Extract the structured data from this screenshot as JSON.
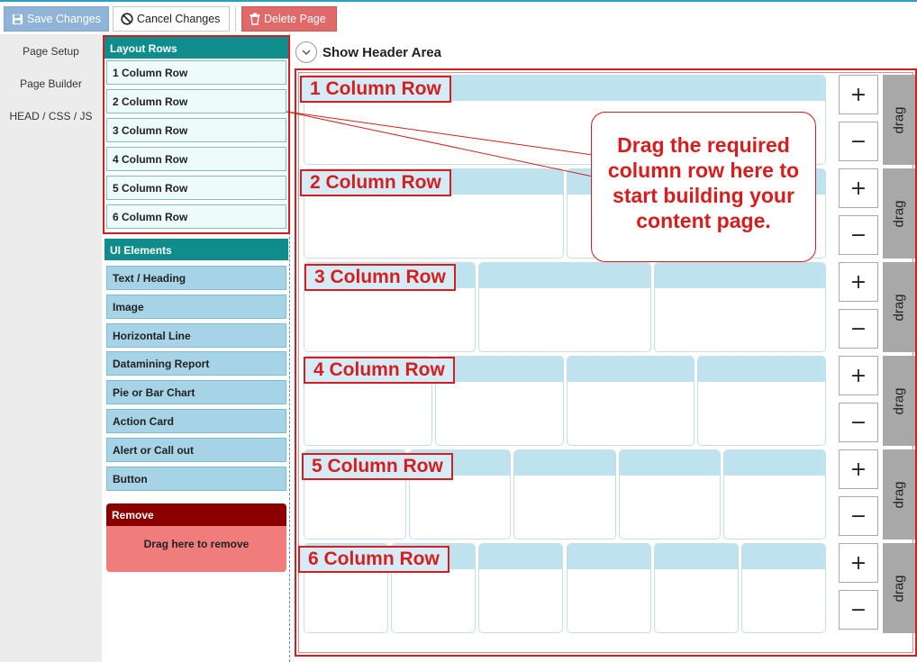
{
  "toolbar": {
    "save_label": "Save Changes",
    "cancel_label": "Cancel Changes",
    "delete_label": "Delete Page"
  },
  "left_nav": {
    "items": [
      {
        "label": "Page Setup"
      },
      {
        "label": "Page Builder"
      },
      {
        "label": "HEAD / CSS / JS"
      }
    ]
  },
  "palette": {
    "layout_rows_title": "Layout Rows",
    "layout_rows": [
      {
        "label": "1 Column Row"
      },
      {
        "label": "2 Column Row"
      },
      {
        "label": "3 Column Row"
      },
      {
        "label": "4 Column Row"
      },
      {
        "label": "5 Column Row"
      },
      {
        "label": "6 Column Row"
      }
    ],
    "ui_elements_title": "UI Elements",
    "ui_elements": [
      {
        "label": "Text / Heading"
      },
      {
        "label": "Image"
      },
      {
        "label": "Horizontal Line"
      },
      {
        "label": "Datamining Report"
      },
      {
        "label": "Pie or Bar Chart"
      },
      {
        "label": "Action Card"
      },
      {
        "label": "Alert or Call out"
      },
      {
        "label": "Button"
      }
    ],
    "remove_title": "Remove",
    "remove_text": "Drag here to remove"
  },
  "main": {
    "header_toggle_label": "Show Header Area",
    "rows": [
      {
        "label": "1 Column Row",
        "columns": 1
      },
      {
        "label": "2 Column Row",
        "columns": 2
      },
      {
        "label": "3 Column Row",
        "columns": 3
      },
      {
        "label": "4 Column Row",
        "columns": 4
      },
      {
        "label": "5 Column Row",
        "columns": 5
      },
      {
        "label": "6 Column Row",
        "columns": 6
      }
    ],
    "plus_symbol": "+",
    "minus_symbol": "−",
    "drag_label": "drag",
    "callout_text": "Drag the required column row here to start building your content page."
  },
  "colors": {
    "annotation_red": "#d71d1d",
    "teal_header": "#0f8c8c",
    "remove_dark": "#8b0000",
    "remove_light": "#f07c7c",
    "save_button": "#8fb4d8",
    "delete_button": "#e06a6a",
    "column_header": "#bfe3ee",
    "drag_handle": "#a8a8a8"
  },
  "icons": {
    "save": "floppy-disk-icon",
    "cancel": "prohibited-icon",
    "delete": "trash-icon",
    "toggle": "chevron-down-icon"
  }
}
